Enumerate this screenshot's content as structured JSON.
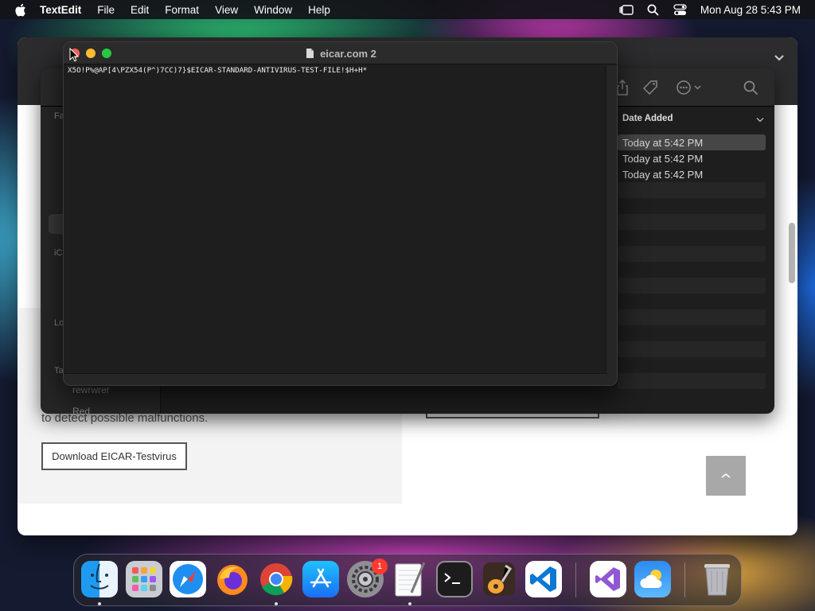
{
  "menubar": {
    "app_name": "TextEdit",
    "menus": [
      "File",
      "Edit",
      "Format",
      "View",
      "Window",
      "Help"
    ],
    "clock": "Mon Aug 28  5:43 PM"
  },
  "browser": {
    "body_text_fragment": "to detect possible malfunctions.",
    "download_button": "Download EICAR-Testvirus"
  },
  "finder": {
    "sidebar_fragments": [
      "Fa",
      "iC",
      "Lo",
      "Ta"
    ],
    "sidebar_tags": [
      "rewrwrer",
      "Red"
    ],
    "column_header": "Date Added",
    "rows": [
      "Today at 5:42 PM",
      "Today at 5:42 PM",
      "Today at 5:42 PM"
    ]
  },
  "textedit": {
    "title": "eicar.com 2",
    "content": "X5O!P%@AP[4\\PZX54(P^)7CC)7}$EICAR-STANDARD-ANTIVIRUS-TEST-FILE!$H+H*"
  },
  "dock": {
    "items": [
      {
        "name": "finder",
        "running": true
      },
      {
        "name": "launchpad",
        "running": false
      },
      {
        "name": "safari",
        "running": false
      },
      {
        "name": "firefox",
        "running": false
      },
      {
        "name": "chrome",
        "running": true
      },
      {
        "name": "app-store",
        "running": false
      },
      {
        "name": "system-settings",
        "running": false
      },
      {
        "name": "textedit",
        "running": true
      },
      {
        "name": "terminal",
        "running": false
      },
      {
        "name": "garageband",
        "running": false
      },
      {
        "name": "vscode",
        "running": false
      },
      {
        "name": "visual-studio",
        "running": false
      },
      {
        "name": "weather",
        "running": false
      },
      {
        "name": "trash",
        "running": false
      }
    ],
    "settings_badge": "1"
  }
}
